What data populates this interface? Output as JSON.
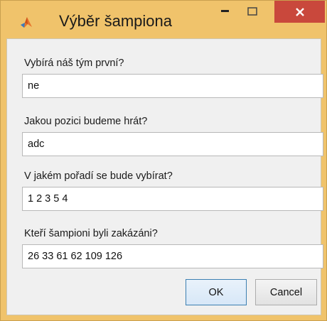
{
  "window": {
    "title": "Výběr šampiona",
    "icon": "matlab-logo-icon",
    "controls": {
      "minimize": "minimize-icon",
      "maximize": "maximize-icon",
      "close": "close-icon"
    },
    "colors": {
      "frame": "#f0c36b",
      "close_button": "#c9483c"
    }
  },
  "form": {
    "fields": [
      {
        "label": "Vybírá náš tým první?",
        "value": "ne"
      },
      {
        "label": "Jakou pozici budeme hrát?",
        "value": "adc"
      },
      {
        "label": "V jakém pořadí se bude vybírat?",
        "value": "1 2 3 5 4"
      },
      {
        "label": "Kteří šampioni byli zakázáni?",
        "value": "26 33 61 62 109 126"
      }
    ]
  },
  "buttons": {
    "ok": "OK",
    "cancel": "Cancel"
  }
}
